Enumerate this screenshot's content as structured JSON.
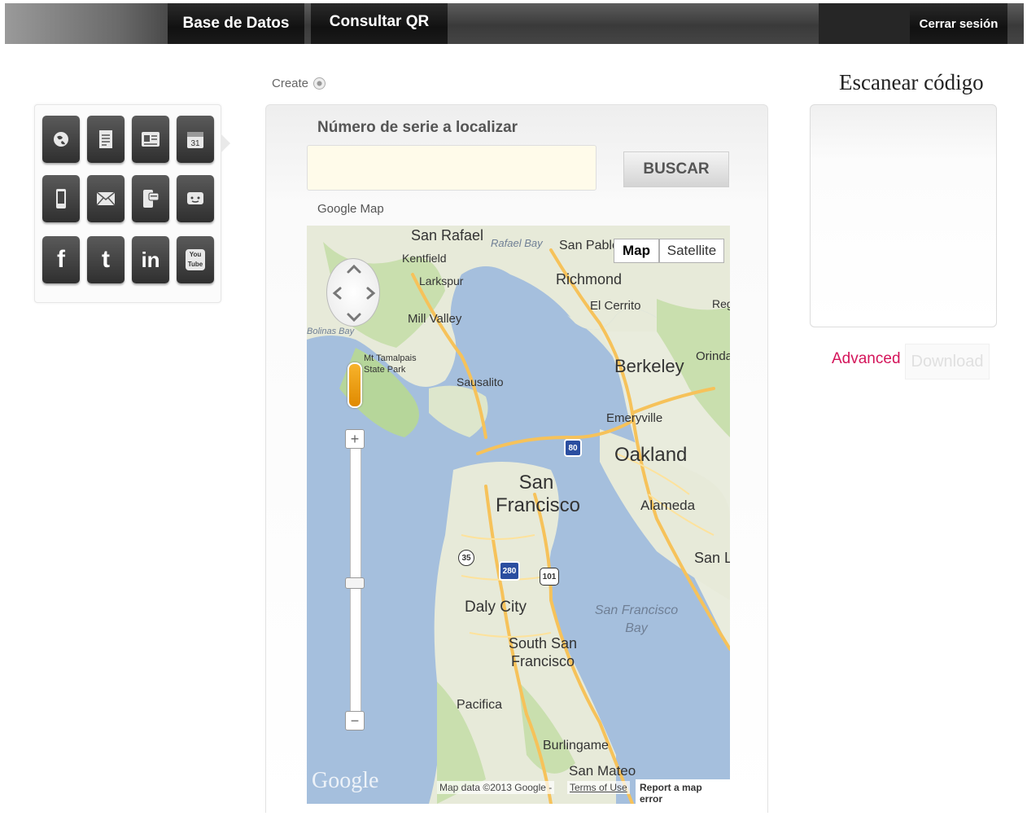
{
  "nav": {
    "tabs": [
      {
        "label": "Base de Datos"
      },
      {
        "label": "Consultar QR"
      }
    ],
    "logout_label": "Cerrar sesión"
  },
  "icons": [
    {
      "name": "globe-icon"
    },
    {
      "name": "document-icon"
    },
    {
      "name": "business-card-icon"
    },
    {
      "name": "calendar-icon",
      "text": "31"
    },
    {
      "name": "phone-icon"
    },
    {
      "name": "email-icon"
    },
    {
      "name": "sms-icon"
    },
    {
      "name": "chat-icon"
    },
    {
      "name": "facebook-icon",
      "text": "f"
    },
    {
      "name": "twitter-icon",
      "text": "t"
    },
    {
      "name": "linkedin-icon",
      "text": "in"
    },
    {
      "name": "youtube-icon",
      "text": "You Tube"
    }
  ],
  "create": {
    "label": "Create"
  },
  "search": {
    "label": "Número de serie a localizar",
    "value": "",
    "button_label": "BUSCAR"
  },
  "map": {
    "label": "Google Map",
    "type_buttons": [
      "Map",
      "Satellite"
    ],
    "active_type": "Map",
    "logo": "Google",
    "attribution": "Map data ©2013 Google -",
    "terms": "Terms of Use",
    "report": "Report a map error",
    "places": [
      "San Rafael",
      "Rafael Bay",
      "San Pablo",
      "Kentfield",
      "Larkspur",
      "Richmond",
      "El Cerrito",
      "Mill Valley",
      "Bolinas Bay",
      "Mt Tamalpais State Park",
      "Berkeley",
      "Orinda",
      "Sausalito",
      "Emeryville",
      "Oakland",
      "San Francisco",
      "Alameda",
      "San L",
      "Daly City",
      "San Francisco Bay",
      "South San Francisco",
      "Pacifica",
      "Burlingame",
      "San Mateo",
      "Reg"
    ],
    "shields": [
      "80",
      "35",
      "280",
      "101"
    ],
    "zoom_buttons": [
      "+",
      "−"
    ]
  },
  "scan": {
    "title": "Escanear código",
    "advanced_label": "Advanced",
    "download_label": "Download"
  }
}
